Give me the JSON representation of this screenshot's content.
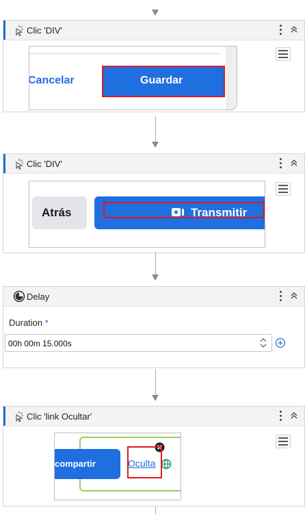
{
  "steps": [
    {
      "title": "Clic 'DIV'",
      "icon": "click-icon"
    },
    {
      "title": "Clic 'DIV'",
      "icon": "click-icon"
    },
    {
      "title": "Delay",
      "icon": "delay-icon"
    },
    {
      "title": "Clic 'link  Ocultar'",
      "icon": "click-icon"
    }
  ],
  "shot1": {
    "cancel_label": "Cancelar",
    "save_label": "Guardar"
  },
  "shot2": {
    "back_label": "Atrás",
    "stream_label": "Transmitir"
  },
  "delay": {
    "duration_label": "Duration",
    "required_mark": "*",
    "duration_value": "00h 00m 15.000s"
  },
  "shot4": {
    "share_label": "compartir",
    "hide_link": "Oculta"
  },
  "colors": {
    "accent": "#1e6fd9",
    "highlight": "#e0181f",
    "button_blue": "#1f6fe0"
  }
}
